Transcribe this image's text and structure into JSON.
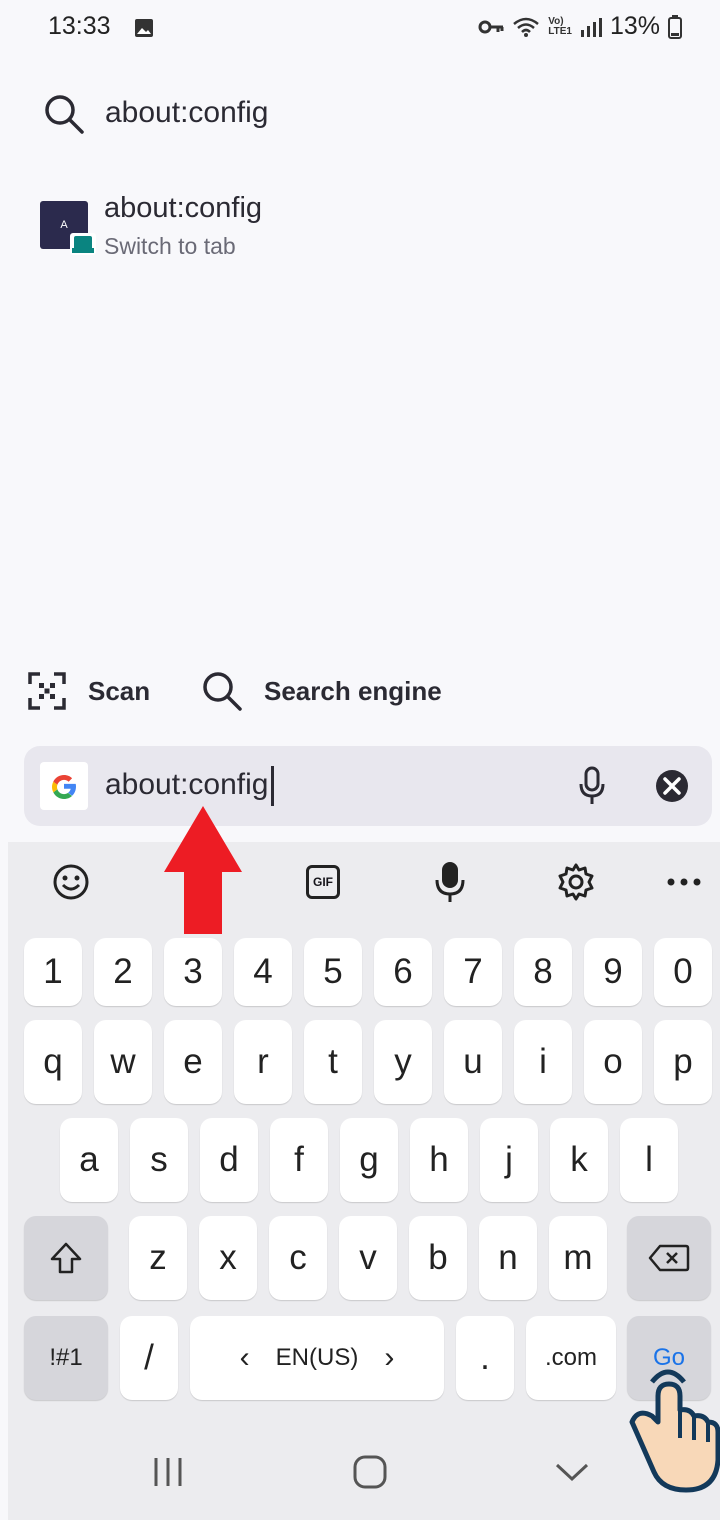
{
  "status_bar": {
    "time": "13:33",
    "battery": "13%"
  },
  "search": {
    "query": "about:config"
  },
  "suggestion": {
    "favicon_letter": "A",
    "title": "about:config",
    "subtitle": "Switch to tab"
  },
  "toolbar": {
    "scan_label": "Scan",
    "search_engine_label": "Search engine"
  },
  "address_bar": {
    "value": "about:config"
  },
  "keyboard": {
    "toolbar_icons": [
      "emoji-icon",
      "gif-icon",
      "microphone-icon",
      "settings-icon",
      "more-icon"
    ],
    "gif_label": "GIF",
    "row_numbers": [
      "1",
      "2",
      "3",
      "4",
      "5",
      "6",
      "7",
      "8",
      "9",
      "0"
    ],
    "row1": [
      "q",
      "w",
      "e",
      "r",
      "t",
      "y",
      "u",
      "i",
      "o",
      "p"
    ],
    "row2": [
      "a",
      "s",
      "d",
      "f",
      "g",
      "h",
      "j",
      "k",
      "l"
    ],
    "row3": [
      "z",
      "x",
      "c",
      "v",
      "b",
      "n",
      "m"
    ],
    "symbols_label": "!#1",
    "slash_label": "/",
    "language_label": "EN(US)",
    "period_label": ".",
    "dotcom_label": ".com",
    "go_label": "Go"
  },
  "colors": {
    "accent": "#1a73e8",
    "annotation_arrow": "#ed1c24"
  }
}
